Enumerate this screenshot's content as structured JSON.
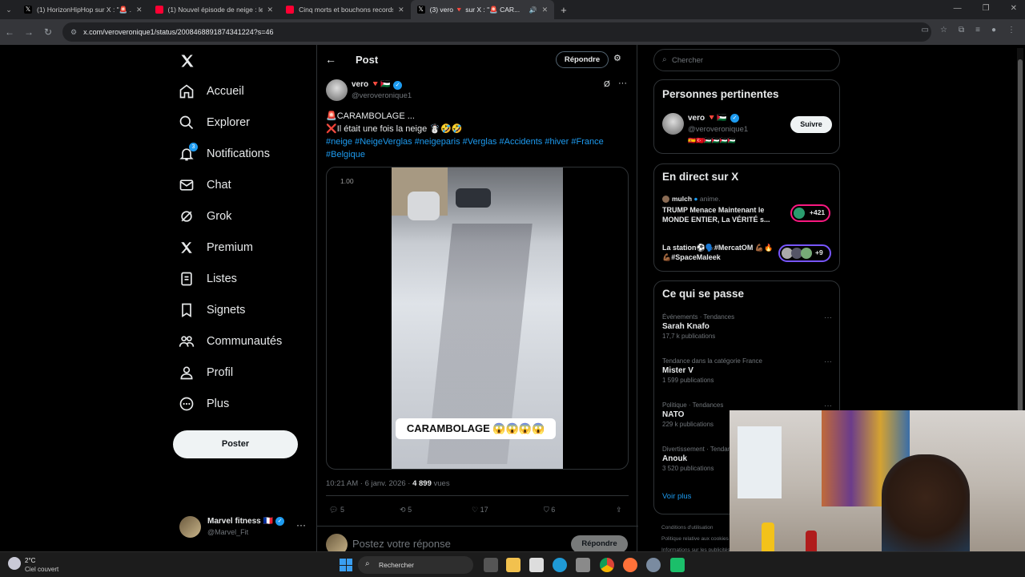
{
  "browser": {
    "tabs": [
      {
        "title": "(1) HorizonHipHop sur X : \"🚨 ...",
        "active": false
      },
      {
        "title": "(1) Nouvel épisode de neige : les ...",
        "active": false
      },
      {
        "title": "Cinq morts et bouchons records ...",
        "active": false
      },
      {
        "title": "(3) vero 🔻 sur X : \"🚨 CAR...",
        "active": true
      }
    ],
    "url": "x.com/veroveronique1/status/2008468891874341224?s=46",
    "new_tab": "+"
  },
  "sidebar": {
    "items": [
      {
        "label": "Accueil",
        "icon": "home-icon"
      },
      {
        "label": "Explorer",
        "icon": "search-icon"
      },
      {
        "label": "Notifications",
        "icon": "bell-icon",
        "badge": "3"
      },
      {
        "label": "Chat",
        "icon": "mail-icon"
      },
      {
        "label": "Grok",
        "icon": "grok-icon"
      },
      {
        "label": "Premium",
        "icon": "x-logo-icon"
      },
      {
        "label": "Listes",
        "icon": "list-icon"
      },
      {
        "label": "Signets",
        "icon": "bookmark-icon"
      },
      {
        "label": "Communautés",
        "icon": "communities-icon"
      },
      {
        "label": "Profil",
        "icon": "person-icon"
      },
      {
        "label": "Plus",
        "icon": "more-circle-icon"
      }
    ],
    "post_button": "Poster",
    "account": {
      "name": "Marvel fitness 🇫🇷",
      "handle": "@Marvel_Fit"
    }
  },
  "header": {
    "title": "Post",
    "reply_button": "Répondre"
  },
  "post": {
    "author": "vero 🔻🇵🇸",
    "handle": "@veroveronique1",
    "line1": "🚨CARAMBOLAGE ...",
    "line2": "❌Il était une fois la neige ☃️🤣🤣",
    "hashtags": "#neige #NeigeVerglas #neigeparis #Verglas #Accidents #hiver #France #Belgique",
    "video_speed": "1.00",
    "video_caption": "CARAMBOLAGE 😱😱😱😱",
    "time": "10:21 AM · 6 janv. 2026 · ",
    "views_count": "4 899",
    "views_label": " vues",
    "replies": "5",
    "reposts": "5",
    "likes": "17",
    "bookmarks": "6",
    "reply_placeholder": "Postez votre réponse",
    "reply_button": "Répondre"
  },
  "right": {
    "search_placeholder": "Chercher",
    "relevant": {
      "title": "Personnes pertinentes",
      "name": "vero 🔻🇵🇸",
      "handle": "@veroveronique1",
      "flags": "🇪🇸🇹🇷🇵🇸🇵🇸🇵🇸🇵🇸",
      "follow": "Suivre"
    },
    "live": {
      "title": "En direct sur X",
      "items": [
        {
          "host": "mulch",
          "hosted": "anime.",
          "title": "TRUMP Menace Maintenant le MONDE ENTIER, La VÉRITÉ s...",
          "count": "+421"
        },
        {
          "host": "",
          "hosted": "",
          "title": "La station⚽🗣️#MercatOM 💪🏾🔥💪🏾#SpaceMaleek",
          "count": "+9"
        }
      ]
    },
    "happening": {
      "title": "Ce qui se passe",
      "trends": [
        {
          "category": "Événements · Tendances",
          "name": "Sarah Knafo",
          "count": "17,7 k publications"
        },
        {
          "category": "Tendance dans la catégorie France",
          "name": "Mister V",
          "count": "1 599 publications"
        },
        {
          "category": "Politique · Tendances",
          "name": "NATO",
          "count": "229 k publications"
        },
        {
          "category": "Divertissement · Tendances",
          "name": "Anouk",
          "count": "3 520 publications"
        }
      ],
      "more": "Voir plus"
    },
    "footer": [
      "Conditions d'utilisation",
      "Politique relative aux cookies",
      "Informations sur les publicités"
    ]
  },
  "taskbar": {
    "weather_temp": "2°C",
    "weather_desc": "Ciel couvert",
    "search": "Rechercher"
  },
  "colors": {
    "accent": "#1d9bf0",
    "bg": "#000000",
    "border": "#2f3336"
  }
}
